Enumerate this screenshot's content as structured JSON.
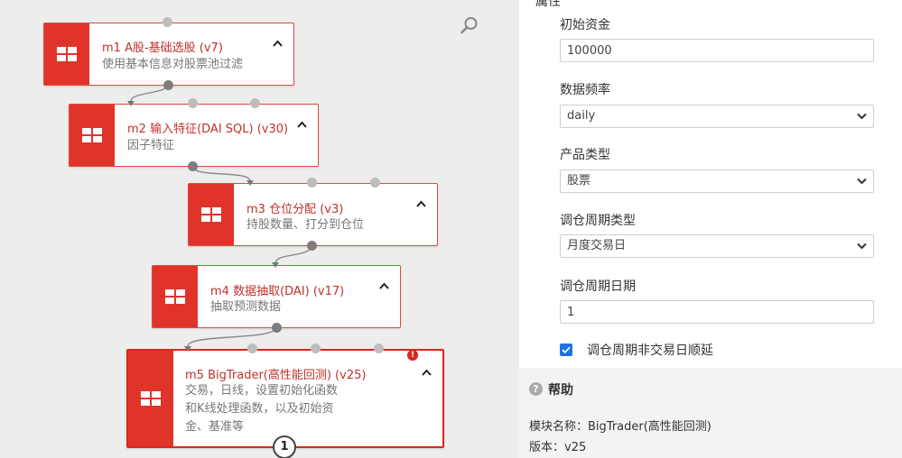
{
  "canvas": {
    "search_icon": "search-icon",
    "nodes": [
      {
        "title": "m1 A股-基础选股 (v7)",
        "desc": [
          "使用基本信息对股票池过滤"
        ]
      },
      {
        "title": "m2 输入特征(DAI SQL) (v30)",
        "desc": [
          "因子特征"
        ]
      },
      {
        "title": "m3 仓位分配 (v3)",
        "desc": [
          "持股数量、打分到仓位"
        ]
      },
      {
        "title": "m4 数据抽取(DAI) (v17)",
        "desc": [
          "抽取预测数据"
        ]
      },
      {
        "title": "m5 BigTrader(高性能回测) (v25)",
        "desc": [
          "交易，日线，设置初始化函数",
          "和K线处理函数，以及初始资",
          "金、基准等"
        ],
        "error_mark": "!",
        "badge": "1"
      }
    ]
  },
  "properties": {
    "heading": "属性",
    "fields": [
      {
        "label": "初始资金",
        "type": "input",
        "value": "100000"
      },
      {
        "label": "数据频率",
        "type": "select",
        "value": "daily"
      },
      {
        "label": "产品类型",
        "type": "select",
        "value": "股票"
      },
      {
        "label": "调仓周期类型",
        "type": "select",
        "value": "月度交易日"
      },
      {
        "label": "调仓周期日期",
        "type": "input",
        "value": "1"
      }
    ],
    "checkbox": {
      "label": "调仓周期非交易日顺延",
      "checked": true
    }
  },
  "help": {
    "icon": "?",
    "title": "帮助",
    "module_name": "模块名称：BigTrader(高性能回测)",
    "version": "版本：v25"
  },
  "colors": {
    "node_accent": "#e0342a",
    "node_title": "#c0312a",
    "checkbox": "#1a73e8"
  }
}
